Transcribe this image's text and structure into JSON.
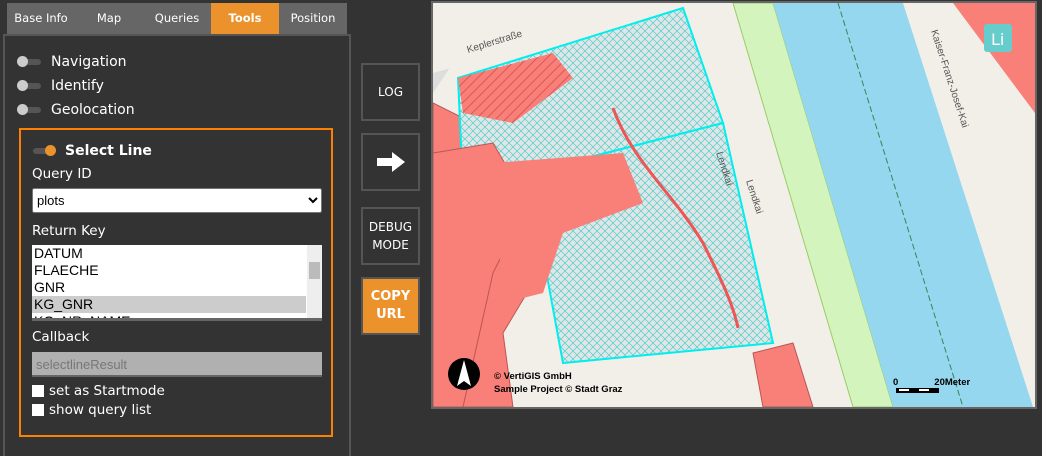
{
  "tabs": [
    "Base Info",
    "Map",
    "Queries",
    "Tools",
    "Position"
  ],
  "active_tab": "Tools",
  "tools": [
    {
      "label": "Navigation",
      "on": false
    },
    {
      "label": "Identify",
      "on": false
    },
    {
      "label": "Geolocation",
      "on": false
    }
  ],
  "select_line": {
    "label": "Select Line",
    "on": true,
    "query_id_label": "Query ID",
    "query_id_value": "plots",
    "return_key_label": "Return Key",
    "return_keys": [
      "DATUM",
      "FLAECHE",
      "GNR",
      "KG_GNR",
      "KG_NR_NAME"
    ],
    "selected_key": "KG_GNR",
    "callback_label": "Callback",
    "callback_placeholder": "selectlineResult",
    "startmode_label": "set as Startmode",
    "startmode_checked": false,
    "querylist_label": "show query list",
    "querylist_checked": false
  },
  "buttons": {
    "log": "LOG",
    "debug": "DEBUG MODE",
    "copy": "COPY URL"
  },
  "map": {
    "streets": [
      "Keplerstraße",
      "Lendkai",
      "Lendkai",
      "Kaiser-Franz-Josef-Kai"
    ],
    "attribution": [
      "© VertiGIS GmbH",
      "Sample Project © Stadt Graz"
    ],
    "scale_min": "0",
    "scale_max": "20Meter",
    "logo": "Li"
  },
  "colors": {
    "accent": "#ec922d",
    "building": "#f88078",
    "selection": "#00e5e5",
    "river": "#94d7ef"
  }
}
